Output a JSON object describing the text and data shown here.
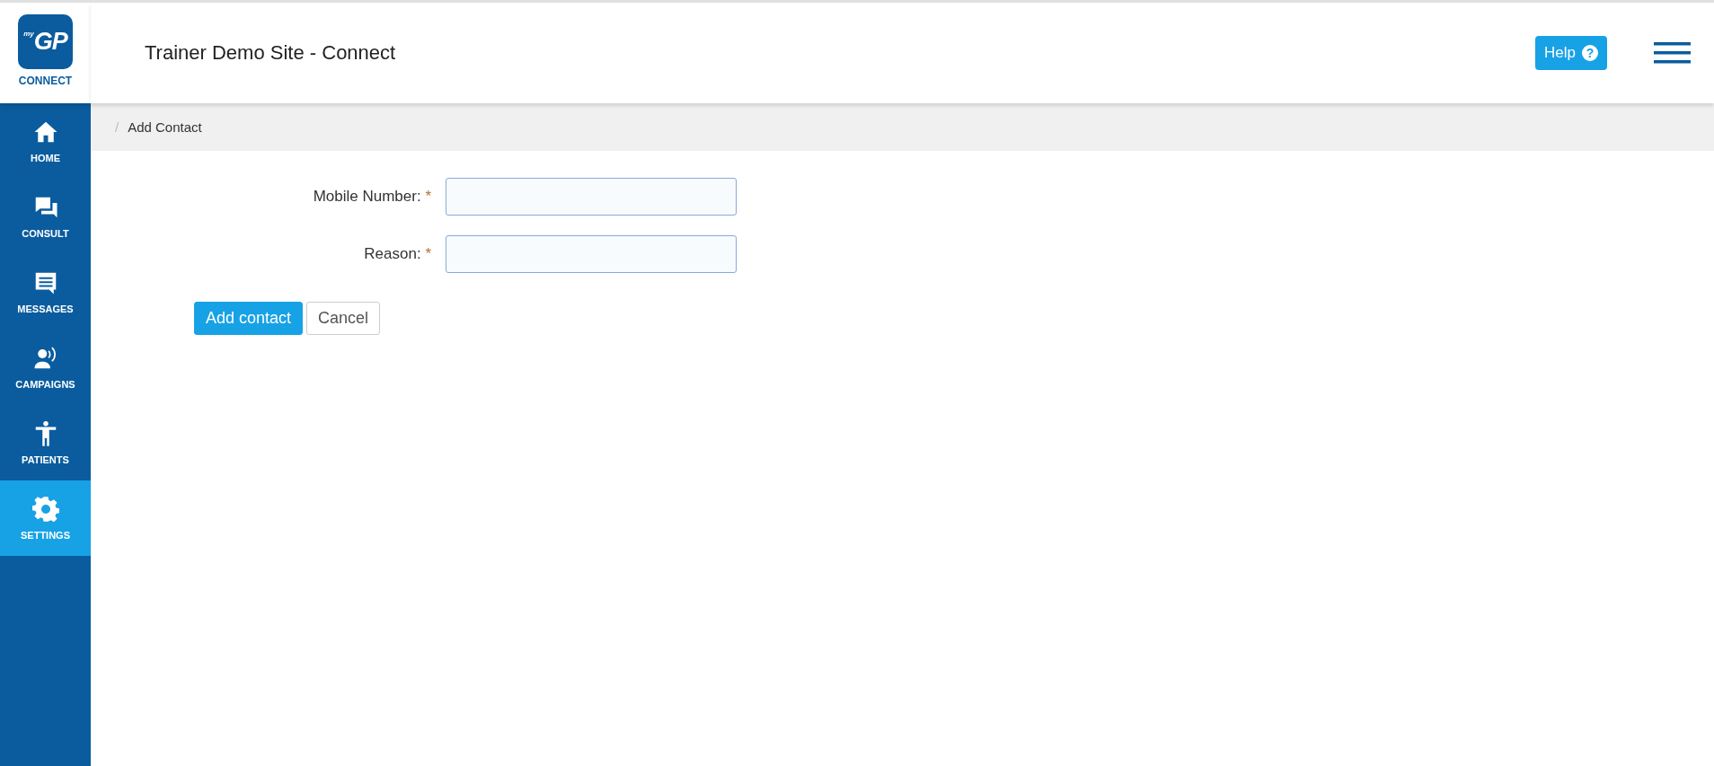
{
  "logo": {
    "prefix": "my",
    "mark": "GP",
    "caption": "CONNECT"
  },
  "header": {
    "title": "Trainer Demo Site - Connect",
    "help_button": "Help",
    "help_icon": "?"
  },
  "sidebar": {
    "items": [
      {
        "label": "HOME",
        "selected": false
      },
      {
        "label": "CONSULT",
        "selected": false
      },
      {
        "label": "MESSAGES",
        "selected": false
      },
      {
        "label": "CAMPAIGNS",
        "selected": false
      },
      {
        "label": "PATIENTS",
        "selected": false
      },
      {
        "label": "SETTINGS",
        "selected": true
      }
    ]
  },
  "breadcrumb": {
    "separator": "/",
    "current": "Add Contact"
  },
  "form": {
    "fields": [
      {
        "label": "Mobile Number:",
        "required_mark": "*"
      },
      {
        "label": "Reason:",
        "required_mark": "*"
      }
    ],
    "buttons": [
      {
        "label": "Add contact",
        "kind": "primary"
      },
      {
        "label": "Cancel",
        "kind": "secondary"
      }
    ]
  }
}
